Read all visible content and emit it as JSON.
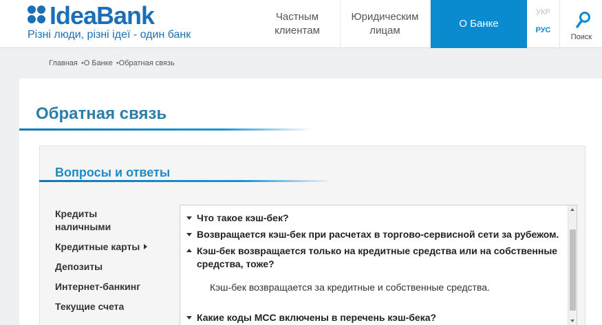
{
  "header": {
    "logo_name": "IdeaBank",
    "logo_slogan": "Різні люди, різні ідеї - один банк",
    "nav": [
      {
        "label_line1": "Частным",
        "label_line2": "клиентам"
      },
      {
        "label_line1": "Юридическим",
        "label_line2": "лицам"
      },
      {
        "label_line1": "О Банке",
        "label_line2": ""
      }
    ],
    "lang": {
      "ukr": "УКР",
      "rus": "РУС"
    },
    "search_label": "Поиск",
    "accent_color": "#0a8bd0",
    "brand_color": "#1a6fb7"
  },
  "breadcrumb": {
    "items": [
      "Главная",
      "О Банке",
      "Обратная связь"
    ],
    "separator": "•"
  },
  "page": {
    "title": "Обратная связь",
    "section_title": "Вопросы и ответы"
  },
  "side_menu": {
    "items": [
      {
        "line1": "Кредиты",
        "line2": "наличными"
      },
      {
        "line1": "Кредитные карты",
        "line2": ""
      },
      {
        "line1": "Депозиты",
        "line2": ""
      },
      {
        "line1": "Интернет-банкинг",
        "line2": ""
      },
      {
        "line1": "Текущие счета",
        "line2": ""
      }
    ]
  },
  "faq": {
    "cut_text": "- - — - - - - - — - - - - - - - - - - -",
    "items": [
      {
        "question": "Что такое кэш-бек?",
        "expanded": false
      },
      {
        "question": "Возвращается кэш-бек при расчетах в торгово-сервисной сети за рубежом.",
        "expanded": false
      },
      {
        "question_line1": "Кэш-бек возвращается только на кредитные средства или на собственные",
        "question_line2": "средства, тоже?",
        "expanded": true,
        "answer": "Кэш-бек возвращается за кредитные и собственные средства."
      },
      {
        "question": "Какие коды МСС включены в перечень кэш-бека?",
        "expanded": false
      }
    ]
  },
  "icons": {
    "logo": "ideabank-logo-icon",
    "search": "search-icon",
    "caret": "chevron-right-icon",
    "collapsed": "triangle-down-icon",
    "expanded": "triangle-up-icon"
  }
}
